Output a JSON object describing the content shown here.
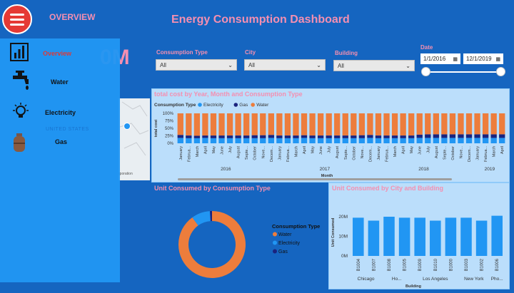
{
  "header": {
    "title": "Energy Consumption Dashboard",
    "overview_label": "OVERVIEW"
  },
  "kpi": {
    "value_fragment": "0M"
  },
  "sidebar": {
    "items": [
      {
        "label": "Overview",
        "icon": "bar-chart-icon"
      },
      {
        "label": "Water",
        "icon": "faucet-icon"
      },
      {
        "label": "Electricity",
        "icon": "bulb-icon"
      },
      {
        "label": "Gas",
        "icon": "gas-cylinder-icon"
      }
    ]
  },
  "filters": {
    "consumption_type": {
      "label": "Consumption Type",
      "value": "All"
    },
    "city": {
      "label": "City",
      "value": "All"
    },
    "building": {
      "label": "Building",
      "value": "All"
    },
    "date": {
      "label": "Date",
      "start": "1/1/2016",
      "end": "12/1/2019",
      "slider_start": 0,
      "slider_end": 1
    }
  },
  "map": {
    "country_label": "UNITED STATES",
    "attribution": "rporation"
  },
  "colors": {
    "electricity": "#2196f3",
    "gas": "#1a237e",
    "water": "#ed7d3c",
    "bar": "#2196f3",
    "title_pink": "#f48fb1"
  },
  "chart_data": [
    {
      "type": "bar",
      "title": "total cost by Year, Month and Consumption Type",
      "legend_title": "Consumption Type",
      "ylabel": "total cost",
      "xlabel": "Month",
      "yticks": [
        "100%",
        "75%",
        "50%",
        "25%",
        "0%"
      ],
      "ylim": [
        0,
        100
      ],
      "stacked_percent": true,
      "categories": [
        "January",
        "Februa...",
        "March",
        "April",
        "May",
        "June",
        "July",
        "August",
        "Septe...",
        "October",
        "Nove...",
        "Decem...",
        "January",
        "Februa...",
        "March",
        "April",
        "May",
        "June",
        "July",
        "August",
        "Septe...",
        "October",
        "Nove...",
        "Decem...",
        "January",
        "Februa...",
        "March",
        "April",
        "May",
        "June",
        "July",
        "August",
        "Septe...",
        "October",
        "Nove...",
        "Decem...",
        "January",
        "Februa...",
        "March",
        "April"
      ],
      "years": [
        {
          "label": "2016",
          "start": 0,
          "count": 12
        },
        {
          "label": "2017",
          "start": 12,
          "count": 12
        },
        {
          "label": "2018",
          "start": 24,
          "count": 12
        },
        {
          "label": "2019",
          "start": 36,
          "count": 4
        }
      ],
      "series": [
        {
          "name": "Electricity",
          "values": [
            18,
            17,
            17,
            18,
            17,
            17,
            17,
            17,
            17,
            17,
            17,
            18,
            17,
            17,
            17,
            18,
            17,
            17,
            17,
            17,
            17,
            17,
            17,
            18,
            17,
            17,
            17,
            17,
            17,
            18,
            18,
            18,
            18,
            18,
            18,
            18,
            18,
            18,
            18,
            18
          ]
        },
        {
          "name": "Gas",
          "values": [
            10,
            9,
            8,
            8,
            9,
            9,
            9,
            9,
            9,
            10,
            10,
            10,
            9,
            9,
            9,
            9,
            9,
            9,
            9,
            9,
            9,
            9,
            10,
            10,
            9,
            9,
            9,
            9,
            9,
            11,
            12,
            12,
            12,
            12,
            12,
            12,
            12,
            12,
            12,
            12
          ]
        },
        {
          "name": "Water",
          "values": [
            72,
            74,
            75,
            74,
            74,
            74,
            74,
            74,
            74,
            73,
            73,
            72,
            74,
            74,
            74,
            73,
            74,
            74,
            74,
            74,
            74,
            74,
            73,
            72,
            74,
            74,
            74,
            74,
            74,
            71,
            70,
            70,
            70,
            70,
            70,
            70,
            70,
            70,
            70,
            70
          ]
        }
      ]
    },
    {
      "type": "pie",
      "title": "Unit Consumed by Consumption Type",
      "legend_title": "Consumption Type",
      "donut": true,
      "labels": [
        "Water",
        "Electricity",
        "Gas"
      ],
      "values": [
        90,
        9,
        1
      ]
    },
    {
      "type": "bar",
      "title": "Unit Consumed by City and Building",
      "ylabel": "Unit Consumed",
      "xlabel": "Building",
      "yticks": [
        "20M",
        "10M",
        "0M"
      ],
      "ylim": [
        0,
        24
      ],
      "categories": [
        "B1004",
        "B1007",
        "B1008",
        "B1005",
        "B1009",
        "B1010",
        "B1000",
        "B1003",
        "B1002",
        "B1006"
      ],
      "values": [
        19.5,
        18,
        20,
        19.5,
        19.5,
        18,
        19.5,
        19.5,
        18,
        20.5
      ],
      "groups": [
        {
          "label": "Chicago",
          "start": 0,
          "count": 2
        },
        {
          "label": "Ho...",
          "start": 2,
          "count": 2
        },
        {
          "label": "Los Angeles",
          "start": 4,
          "count": 3
        },
        {
          "label": "New York",
          "start": 7,
          "count": 2
        },
        {
          "label": "Pho...",
          "start": 9,
          "count": 1
        }
      ]
    }
  ]
}
